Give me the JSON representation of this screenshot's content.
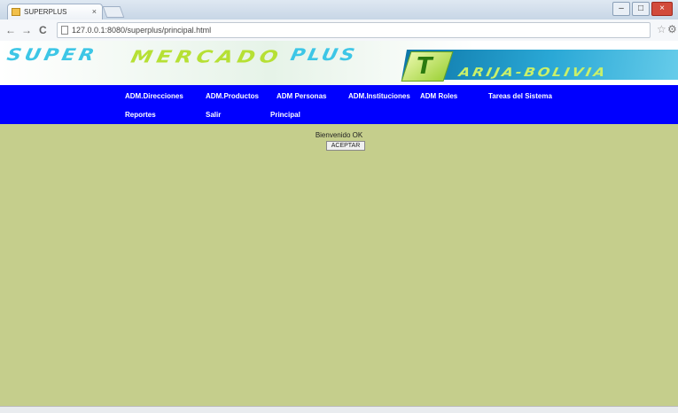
{
  "browser": {
    "tab_title": "SUPERPLUS",
    "tab_close": "×",
    "url": "127.0.0.1:8080/superplus/principal.html",
    "back": "←",
    "forward": "→",
    "reload": "C",
    "star": "☆",
    "wrench": "⚙",
    "minimize": "–",
    "maximize": "□",
    "close": "×"
  },
  "banner": {
    "super": "SUPER",
    "mercado": "MERCADO",
    "plus": "PLUS",
    "t_letter": "T",
    "tarija": "ARIJA-BOLIVIA"
  },
  "menu": {
    "items": [
      "ADM.Direcciones",
      "ADM.Productos",
      "ADM Personas",
      "ADM.Instituciones",
      "ADM Roles",
      "Tareas del Sistema",
      "Reportes",
      "Salir",
      "Principal"
    ]
  },
  "content": {
    "status_text": "Bienvenido OK",
    "button_label": "ACEPTAR"
  },
  "colors": {
    "menu_bg": "#0000ff",
    "content_bg": "#c5ce8c",
    "logo_cyan": "#3dc6e6",
    "logo_green": "#b6e034"
  }
}
